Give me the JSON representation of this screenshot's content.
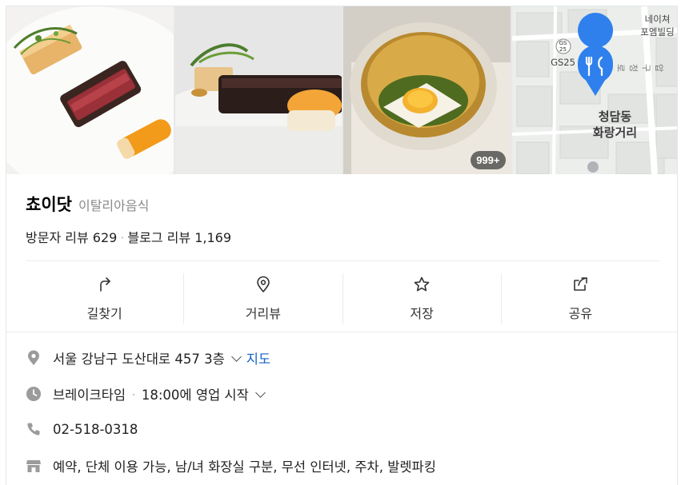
{
  "photos": {
    "count_badge": "999+"
  },
  "map": {
    "label_naver": "네이쳐\n포엠빌딩",
    "label_gs_badge": "GS\n25",
    "label_gs": "GS25",
    "place_name": "청담동\n화랑거리",
    "road_name": "압구정로",
    "pin_icon": "restaurant-pin-icon"
  },
  "place": {
    "name": "쵸이닷",
    "category": "이탈리아음식",
    "visitor_reviews_label": "방문자 리뷰",
    "visitor_reviews_count": "629",
    "blog_reviews_label": "블로그 리뷰",
    "blog_reviews_count": "1,169"
  },
  "actions": [
    {
      "label": "길찾기",
      "icon": "directions-icon"
    },
    {
      "label": "거리뷰",
      "icon": "location-pin-icon"
    },
    {
      "label": "저장",
      "icon": "star-icon"
    },
    {
      "label": "공유",
      "icon": "share-icon"
    }
  ],
  "info": {
    "address": "서울 강남구 도산대로 457 3층",
    "map_link": "지도",
    "hours_status": "브레이크타임",
    "hours_detail": "18:00에 영업 시작",
    "phone": "02-518-0318",
    "amenities": "예약, 단체 이용 가능, 남/녀 화장실 구분, 무선 인터넷, 주차, 발렛파킹"
  },
  "colors": {
    "link": "#1563c7",
    "icon_gray": "#9b9b9b",
    "pin_blue": "#2f80ed"
  }
}
